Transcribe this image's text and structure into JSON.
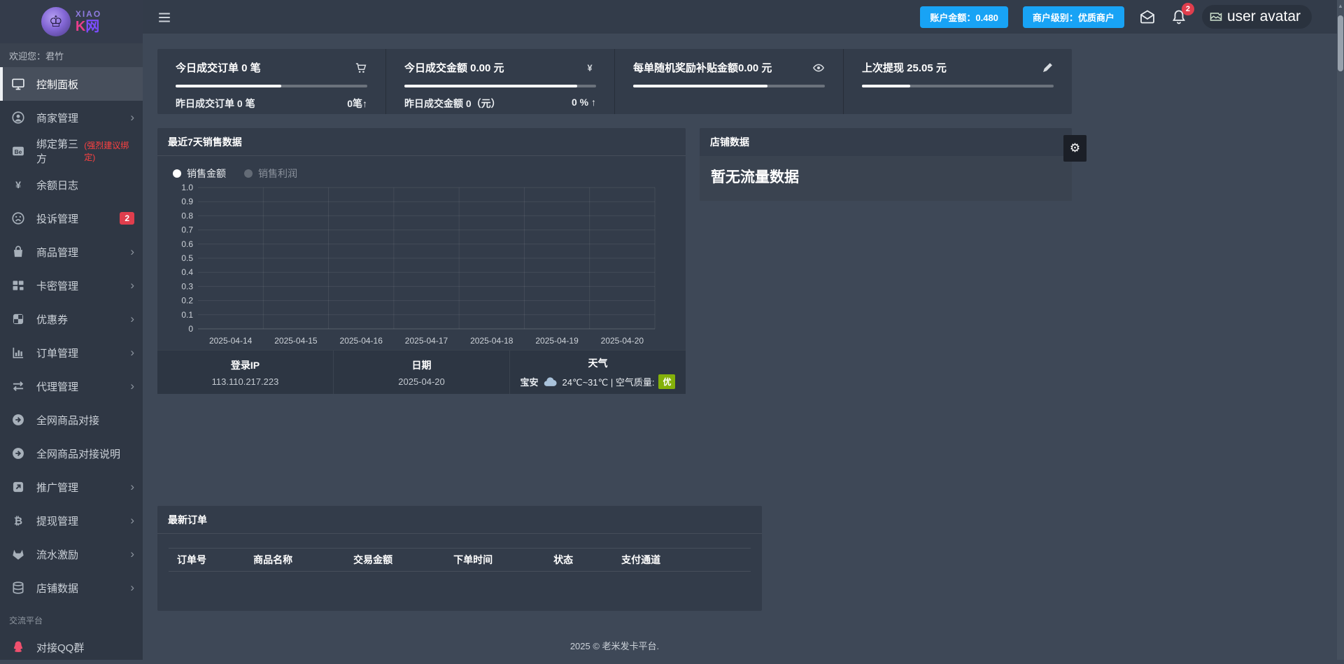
{
  "colors": {
    "accent_blue": "#18a3f5",
    "badge_red": "#e03e4d",
    "aqi_green": "#84b10a",
    "card_bg": "#333c4a",
    "sidebar_bg": "#2f3744",
    "main_bg": "#3e4857"
  },
  "sidebar": {
    "brand_top": "XIAO",
    "brand_k": "K",
    "brand_net": "网",
    "greeting": "欢迎您：君竹",
    "items": [
      {
        "key": "dashboard",
        "label": "控制面板",
        "icon": "monitor-icon",
        "active": true
      },
      {
        "key": "merchant-management",
        "label": "商家管理",
        "icon": "user-icon",
        "chevron": true
      },
      {
        "key": "bind-third-party",
        "label": "绑定第三方",
        "note": "(强烈建议绑定)",
        "icon": "be-icon"
      },
      {
        "key": "balance-log",
        "label": "余额日志",
        "icon": "yen-icon"
      },
      {
        "key": "complaint-management",
        "label": "投诉管理",
        "icon": "frown-icon",
        "badge": "2"
      },
      {
        "key": "product-management",
        "label": "商品管理",
        "icon": "bag-icon",
        "chevron": true
      },
      {
        "key": "card-secret-management",
        "label": "卡密管理",
        "icon": "grid-icon",
        "chevron": true
      },
      {
        "key": "coupons",
        "label": "优惠券",
        "icon": "checker-icon",
        "chevron": true
      },
      {
        "key": "order-management",
        "label": "订单管理",
        "icon": "bar-chart-icon",
        "chevron": true
      },
      {
        "key": "agent-management",
        "label": "代理管理",
        "icon": "swap-icon",
        "chevron": true
      },
      {
        "key": "all-network-product-link",
        "label": "全网商品对接",
        "icon": "arrow-circle-icon"
      },
      {
        "key": "all-network-product-link-guide",
        "label": "全网商品对接说明",
        "icon": "arrow-circle-icon"
      },
      {
        "key": "promotion-management",
        "label": "推广管理",
        "icon": "external-link-icon",
        "chevron": true
      },
      {
        "key": "withdrawal-management",
        "label": "提现管理",
        "icon": "bitcoin-icon",
        "chevron": true
      },
      {
        "key": "flow-incentive",
        "label": "流水激励",
        "icon": "gitlab-icon",
        "chevron": true
      },
      {
        "key": "shop-data",
        "label": "店铺数据",
        "icon": "database-icon",
        "chevron": true
      }
    ],
    "section_label": "交流平台",
    "qq_item": {
      "key": "qq-group",
      "label": "对接QQ群",
      "icon": "qq-icon"
    }
  },
  "topbar": {
    "balance_label": "账户金额：0.480",
    "level_label": "商户级别：优质商户",
    "notification_count": "2",
    "avatar_alt": "user avatar"
  },
  "stat_cards": [
    {
      "title": "今日成交订单 0 笔",
      "icon": "cart-icon",
      "progress": 55,
      "sub_left": "昨日成交订单 0 笔",
      "sub_right": "0笔↑"
    },
    {
      "title": "今日成交金额 0.00 元",
      "icon": "yen-icon",
      "progress": 90,
      "sub_left": "昨日成交金额 0（元）",
      "sub_right": "0 % ↑"
    },
    {
      "title": "每单随机奖励补贴金额0.00 元",
      "icon": "eye-icon",
      "progress": 70,
      "sub_left": "",
      "sub_right": ""
    },
    {
      "title": "上次提现 25.05 元",
      "icon": "pen-icon",
      "progress": 25,
      "sub_left": "",
      "sub_right": ""
    }
  ],
  "chart_card": {
    "title": "最近7天销售数据",
    "info": [
      {
        "label": "登录IP",
        "value": "113.110.217.223"
      },
      {
        "label": "日期",
        "value": "2025-04-20"
      },
      {
        "label": "天气",
        "city": "宝安",
        "text": "24℃~31℃ | 空气质量:",
        "badge": "优"
      }
    ]
  },
  "chart_data": {
    "type": "line",
    "title": "最近7天销售数据",
    "x": [
      "2025-04-14",
      "2025-04-15",
      "2025-04-16",
      "2025-04-17",
      "2025-04-18",
      "2025-04-19",
      "2025-04-20"
    ],
    "series": [
      {
        "name": "销售金额",
        "values": [
          0,
          0,
          0,
          0,
          0,
          0,
          0
        ]
      },
      {
        "name": "销售利润",
        "values": [
          0,
          0,
          0,
          0,
          0,
          0,
          0
        ]
      }
    ],
    "legend": [
      {
        "label": "销售金额",
        "active": true
      },
      {
        "label": "销售利润",
        "active": false
      }
    ],
    "ylim": [
      0,
      1.0
    ],
    "yticks": [
      "0",
      "0.1",
      "0.2",
      "0.3",
      "0.4",
      "0.5",
      "0.6",
      "0.7",
      "0.8",
      "0.9",
      "1.0"
    ],
    "xlabel": "",
    "ylabel": "",
    "grid": true,
    "legend_position": "top-left"
  },
  "shop_panel": {
    "title": "店铺数据",
    "empty_text": "暂无流量数据"
  },
  "orders_card": {
    "title": "最新订单",
    "columns": [
      "订单号",
      "商品名称",
      "交易金额",
      "下单时间",
      "状态",
      "支付通道"
    ],
    "rows": []
  },
  "footer": {
    "copyright": "2025 © 老米发卡平台."
  }
}
